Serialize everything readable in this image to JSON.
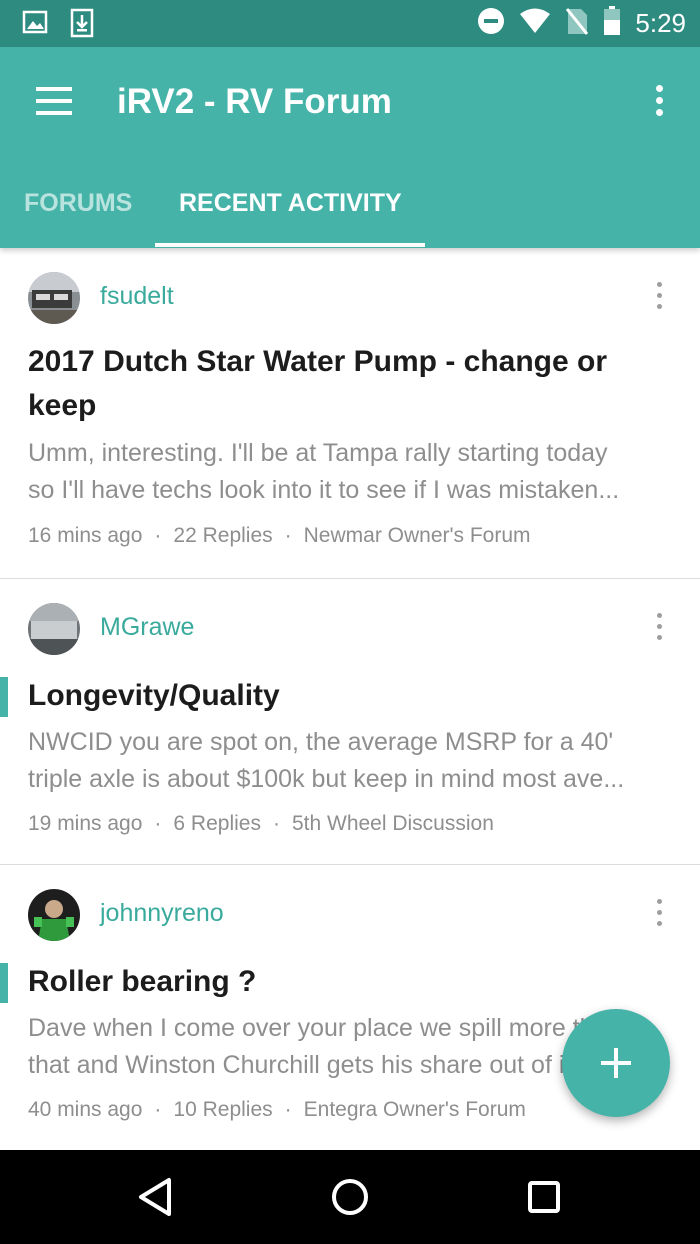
{
  "status_bar": {
    "time": "5:29",
    "icons": [
      "image-icon",
      "download-icon",
      "do-not-disturb-icon",
      "wifi-icon",
      "no-sim-icon",
      "battery-icon"
    ]
  },
  "app_bar": {
    "title": "iRV2 - RV Forum",
    "menu_icon": "hamburger-menu-icon",
    "overflow_icon": "more-vert-icon"
  },
  "tabs": [
    {
      "label": "FORUMS",
      "active": false
    },
    {
      "label": "RECENT ACTIVITY",
      "active": true
    }
  ],
  "posts": [
    {
      "username": "fsudelt",
      "title": "2017 Dutch Star Water Pump - change or keep",
      "snippet": [
        "Umm, interesting. I'll be at Tampa rally starting today",
        "so I'll have techs look into it to see if I was mistaken..."
      ],
      "time_ago": "16 mins ago",
      "replies": "22 Replies",
      "forum": "Newmar Owner's Forum",
      "unread": false
    },
    {
      "username": "MGrawe",
      "title": "Longevity/Quality",
      "snippet": [
        "NWCID you are spot on, the average MSRP for a 40'",
        "triple axle is about $100k but keep in mind most ave..."
      ],
      "time_ago": "19 mins ago",
      "replies": "6 Replies",
      "forum": "5th Wheel Discussion",
      "unread": true
    },
    {
      "username": "johnnyreno",
      "title": "Roller bearing ?",
      "snippet": [
        "Dave when I come over your place we spill more than",
        "that and Winston Churchill gets his share out of it..."
      ],
      "time_ago": "40 mins ago",
      "replies": "10 Replies",
      "forum": "Entegra Owner's Forum",
      "unread": true
    }
  ],
  "fab": {
    "icon": "plus-icon"
  },
  "nav_bar": {
    "icons": [
      "back-icon",
      "home-icon",
      "recents-icon"
    ]
  },
  "colors": {
    "primary": "#45b3a8",
    "primary_dark": "#2e8b80",
    "accent_text": "#3aaa9d"
  }
}
